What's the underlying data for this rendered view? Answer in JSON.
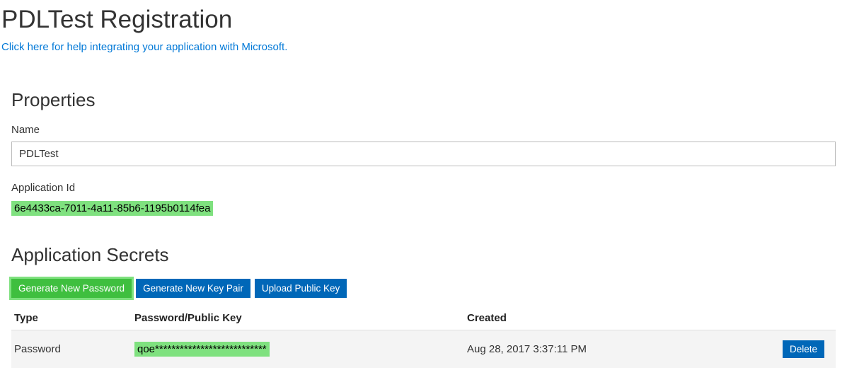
{
  "header": {
    "title": "PDLTest Registration",
    "help_link_text": "Click here for help integrating your application with Microsoft."
  },
  "properties": {
    "section_title": "Properties",
    "name_label": "Name",
    "name_value": "PDLTest",
    "app_id_label": "Application Id",
    "app_id_value": "6e4433ca-7011-4a11-85b6-1195b0114fea"
  },
  "secrets": {
    "section_title": "Application Secrets",
    "buttons": {
      "generate_password": "Generate New Password",
      "generate_keypair": "Generate New Key Pair",
      "upload_public_key": "Upload Public Key"
    },
    "columns": {
      "type": "Type",
      "key": "Password/Public Key",
      "created": "Created"
    },
    "rows": [
      {
        "type": "Password",
        "key_masked": "qoe***************************",
        "created": "Aug 28, 2017 3:37:11 PM",
        "delete_label": "Delete"
      }
    ]
  }
}
